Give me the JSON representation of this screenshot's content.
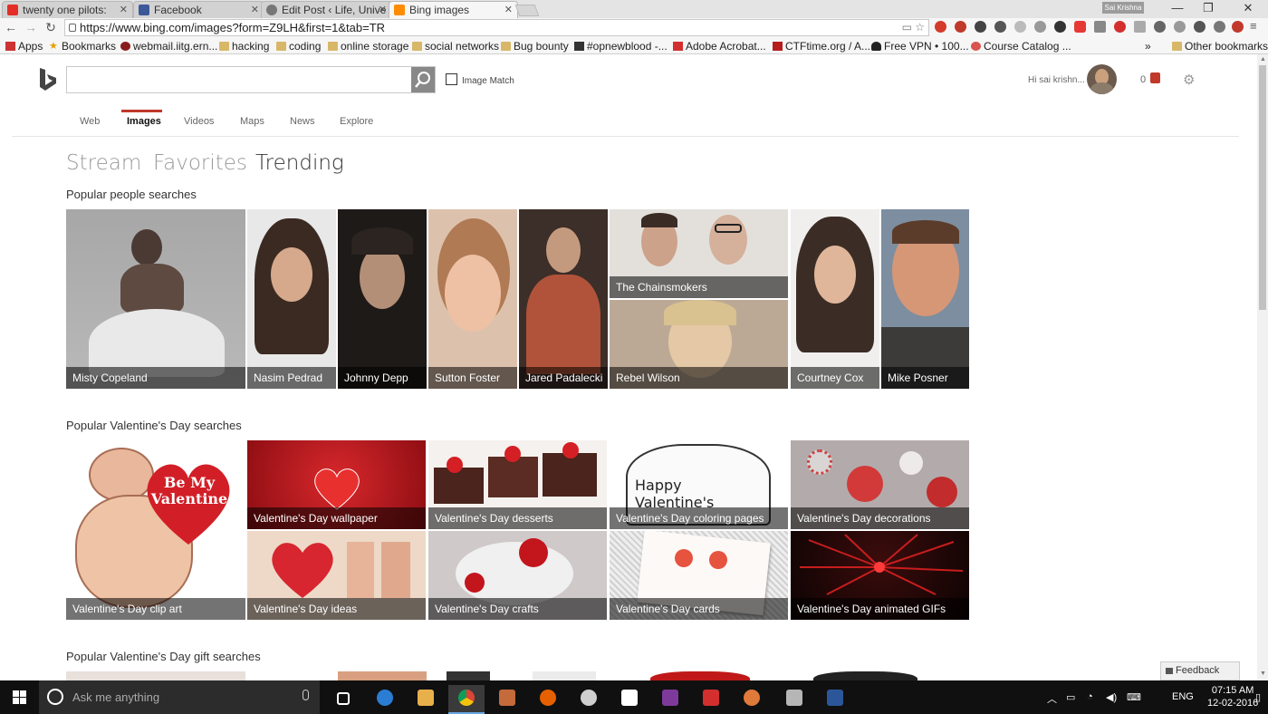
{
  "browser": {
    "tabs": [
      {
        "title": "twenty one pilots:",
        "favicon_color": "#e52d27",
        "active": false
      },
      {
        "title": "Facebook",
        "favicon_color": "#3b5998",
        "active": false
      },
      {
        "title": "Edit Post ‹ Life, Unive",
        "favicon_color": "#777777",
        "active": false
      },
      {
        "title": "Bing images",
        "favicon_color": "#ff8c00",
        "active": true
      }
    ],
    "profile_name": "Sai Krishna",
    "url": "https://www.bing.com/images?form=Z9LH&first=1&tab=TR",
    "bookmarks": [
      {
        "label": "Apps",
        "icon": "apps-grid-icon"
      },
      {
        "label": "Bookmarks",
        "icon": "star-icon"
      },
      {
        "label": "webmail.iitg.ern...",
        "icon": "mail-icon"
      },
      {
        "label": "hacking",
        "icon": "folder-icon"
      },
      {
        "label": "coding",
        "icon": "folder-icon"
      },
      {
        "label": "online storage",
        "icon": "folder-icon"
      },
      {
        "label": "social networks",
        "icon": "folder-icon"
      },
      {
        "label": "Bug bounty",
        "icon": "folder-icon"
      },
      {
        "label": "#opnewblood -...",
        "icon": "irc-icon"
      },
      {
        "label": "Adobe Acrobat...",
        "icon": "acrobat-icon"
      },
      {
        "label": "CTFtime.org / A...",
        "icon": "flag-icon"
      },
      {
        "label": "Free VPN • 100...",
        "icon": "fire-icon"
      },
      {
        "label": "Course Catalog ...",
        "icon": "course-icon"
      },
      {
        "label": "»",
        "icon": ""
      },
      {
        "label": "Other bookmarks",
        "icon": "folder-icon"
      }
    ]
  },
  "bing": {
    "search_value": "",
    "image_match_label": "Image Match",
    "greeting": "Hi sai krishn...",
    "rewards_count": "0",
    "scopes": [
      "Web",
      "Images",
      "Videos",
      "Maps",
      "News",
      "Explore"
    ],
    "active_scope": "Images",
    "subtabs": [
      "Stream",
      "Favorites",
      "Trending"
    ],
    "active_subtab": "Trending",
    "sections": [
      {
        "title": "Popular people searches",
        "tiles": [
          {
            "label": "Misty Copeland",
            "bg": "#a9a9a9"
          },
          {
            "label": "Nasim Pedrad",
            "bg": "#5a4438"
          },
          {
            "label": "Johnny Depp",
            "bg": "#2a2522"
          },
          {
            "label": "Sutton Foster",
            "bg": "#c98f6a"
          },
          {
            "label": "Jared Padalecki",
            "bg": "#8a5a45"
          },
          {
            "label": "The Chainsmokers",
            "bg": "#d7d3cf"
          },
          {
            "label": "Rebel Wilson",
            "bg": "#c9b8a6"
          },
          {
            "label": "Courtney Cox",
            "bg": "#5c4a3e"
          },
          {
            "label": "Mike Posner",
            "bg": "#c58b6d"
          }
        ]
      },
      {
        "title": "Popular Valentine's Day searches",
        "tiles": [
          {
            "label": "Valentine's Day clip art",
            "bg": "#f7efe7"
          },
          {
            "label": "Valentine's Day wallpaper",
            "bg": "#b3141a"
          },
          {
            "label": "Valentine's Day desserts",
            "bg": "#5b2d25"
          },
          {
            "label": "Valentine's Day coloring pages",
            "bg": "#f2f2f2"
          },
          {
            "label": "Valentine's Day decorations",
            "bg": "#a9a2a2"
          },
          {
            "label": "Valentine's Day ideas",
            "bg": "#e8c7b3"
          },
          {
            "label": "Valentine's Day crafts",
            "bg": "#d9d3d3"
          },
          {
            "label": "Valentine's Day cards",
            "bg": "#e6e6e6"
          },
          {
            "label": "Valentine's Day animated GIFs",
            "bg": "#1a0808"
          }
        ]
      },
      {
        "title": "Popular Valentine's Day gift searches",
        "tiles": []
      }
    ],
    "clip_art_text": "Be My Valentine",
    "coloring_text": "Happy Valentine's",
    "feedback_label": "Feedback"
  },
  "taskbar": {
    "search_placeholder": "Ask me anything",
    "apps": [
      "task-view-icon",
      "edge-icon",
      "file-explorer-icon",
      "chrome-icon",
      "app-icon",
      "firefox-icon",
      "eagle-icon",
      "store-icon",
      "onenote-icon",
      "acrobat-icon",
      "media-icon",
      "calendar-icon",
      "word-icon"
    ],
    "language": "ENG",
    "time": "07:15 AM",
    "date": "12-02-2016"
  }
}
